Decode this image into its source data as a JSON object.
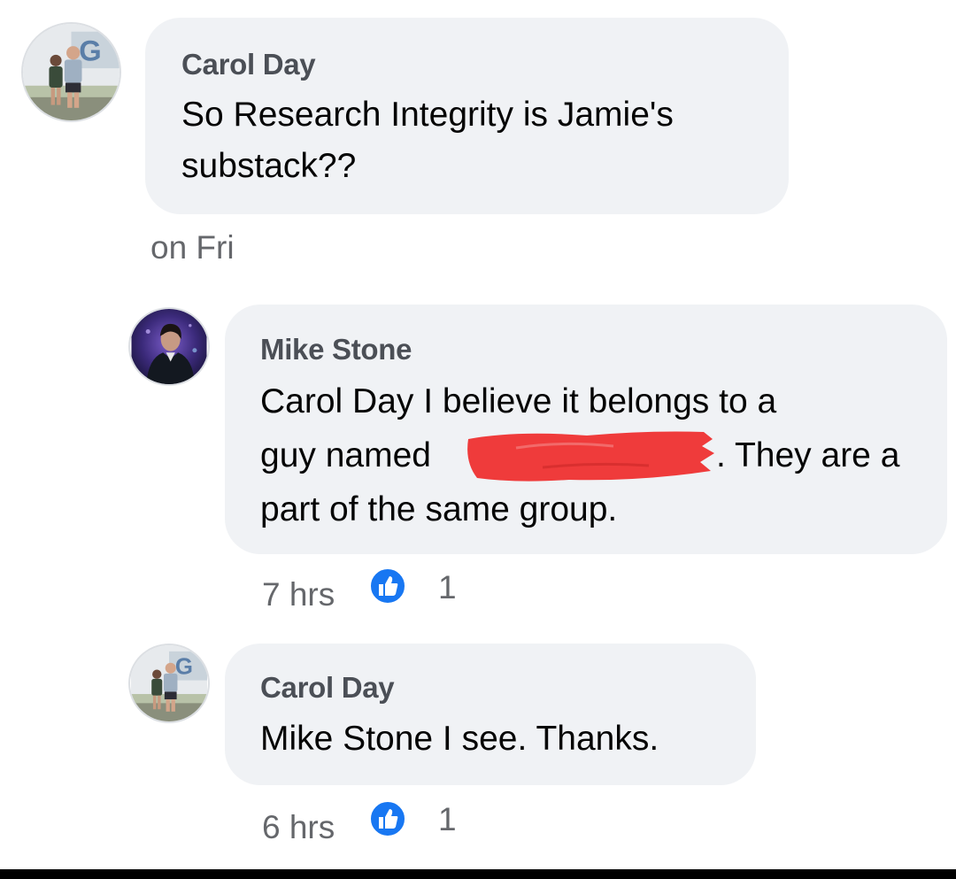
{
  "comments": [
    {
      "author": "Carol Day",
      "lines": [
        "So Research Integrity is Jamie's",
        "substack??"
      ],
      "time": "on Fri"
    },
    {
      "author": "Mike Stone",
      "lines": [
        "Carol Day I believe it belongs to a",
        "guy named",
        ". They are a",
        "part of the same group."
      ],
      "time": "7 hrs",
      "reaction_count": "1"
    },
    {
      "author": "Carol Day",
      "lines": [
        "Mike Stone I see. Thanks."
      ],
      "time": "6 hrs",
      "reaction_count": "1"
    }
  ],
  "colors": {
    "bubble": "#f0f2f5",
    "author_text": "#4b4f56",
    "meta_text": "#65676b",
    "like_blue": "#1877f2",
    "redaction_red": "#ef3b3b"
  },
  "icons": [
    "avatar-photo-carol",
    "avatar-photo-mike",
    "like-icon"
  ]
}
